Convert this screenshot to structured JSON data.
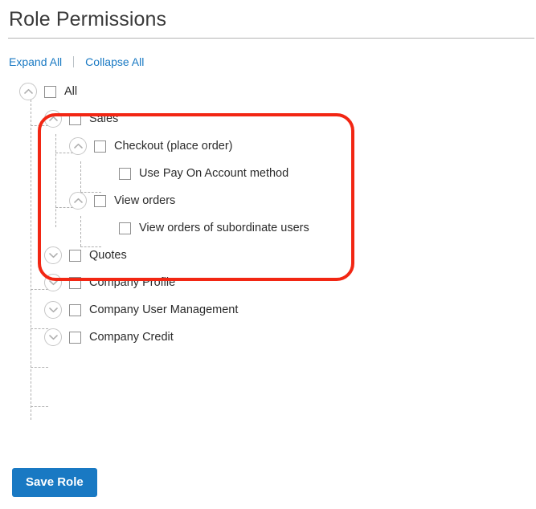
{
  "header": {
    "title": "Role Permissions"
  },
  "toolbar": {
    "expand_all_label": "Expand All",
    "collapse_all_label": "Collapse All",
    "separator": "|"
  },
  "tree": {
    "nodes": [
      {
        "id": "all",
        "label": "All",
        "level": 0,
        "toggle": "chevron-up-icon",
        "checked": false,
        "has_toggle": true
      },
      {
        "id": "sales",
        "label": "Sales",
        "level": 1,
        "toggle": "chevron-up-icon",
        "checked": false,
        "has_toggle": true
      },
      {
        "id": "checkout",
        "label": "Checkout (place order)",
        "level": 2,
        "toggle": "chevron-up-icon",
        "checked": false,
        "has_toggle": true
      },
      {
        "id": "pay-on-account",
        "label": "Use Pay On Account method",
        "level": 3,
        "toggle": "none",
        "checked": false,
        "has_toggle": false
      },
      {
        "id": "view-orders",
        "label": "View orders",
        "level": 2,
        "toggle": "chevron-up-icon",
        "checked": false,
        "has_toggle": true
      },
      {
        "id": "view-orders-subordinate",
        "label": "View orders of subordinate users",
        "level": 3,
        "toggle": "none",
        "checked": false,
        "has_toggle": false
      },
      {
        "id": "quotes",
        "label": "Quotes",
        "level": 1,
        "toggle": "chevron-down-icon",
        "checked": false,
        "has_toggle": true
      },
      {
        "id": "company-profile",
        "label": "Company Profile",
        "level": 1,
        "toggle": "chevron-down-icon",
        "checked": false,
        "has_toggle": true
      },
      {
        "id": "company-user-management",
        "label": "Company User Management",
        "level": 1,
        "toggle": "chevron-down-icon",
        "checked": false,
        "has_toggle": true
      },
      {
        "id": "company-credit",
        "label": "Company Credit",
        "level": 1,
        "toggle": "chevron-down-icon",
        "checked": false,
        "has_toggle": true
      }
    ]
  },
  "annotation": {
    "shape": "rounded-rectangle",
    "color": "#f22613",
    "highlights": "sales-subtree"
  },
  "footer": {
    "save_label": "Save Role"
  },
  "colors": {
    "link": "#1979c3",
    "button": "#1979c3",
    "annotation": "#f22613",
    "title": "#3a3a3a",
    "tree_line": "#b0b0b0"
  }
}
